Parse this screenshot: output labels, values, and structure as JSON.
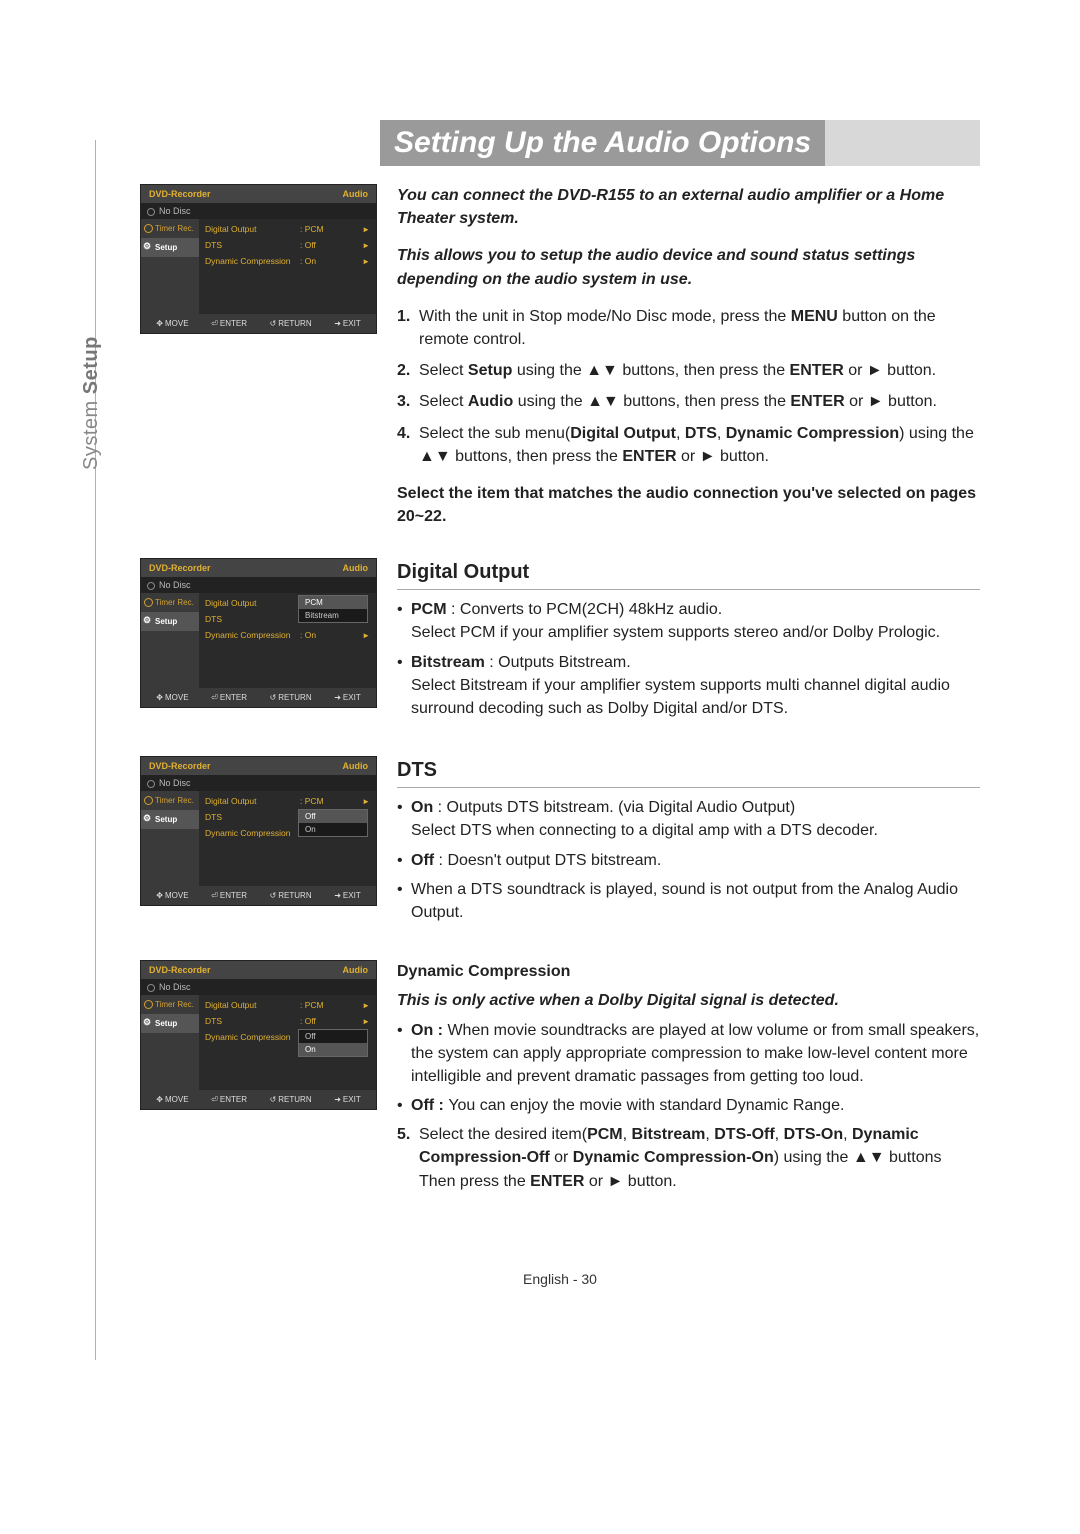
{
  "side_tab_a": "System ",
  "side_tab_b": "Setup",
  "title": "Setting Up the Audio Options",
  "intro1": "You can connect the DVD-R155 to an external audio amplifier or a Home Theater system.",
  "intro2": "This allows you to setup the audio device and sound status settings depending on the audio system in use.",
  "steps": {
    "s1a": "1.",
    "s1b": "With the unit in Stop mode/No Disc mode, press the ",
    "s1c": "MENU",
    "s1d": " button on the remote control.",
    "s2a": "2.",
    "s2b": "Select ",
    "s2c": "Setup",
    "s2d": " using the ▲▼ buttons, then press the ",
    "s2e": "ENTER",
    "s2f": " or ► button.",
    "s3a": "3.",
    "s3b": "Select ",
    "s3c": "Audio",
    "s3d": " using the ▲▼ buttons, then press the ",
    "s3e": "ENTER",
    "s3f": " or ► button.",
    "s4a": "4.",
    "s4b": "Select the sub menu(",
    "s4c": "Digital Output",
    "s4d": ", ",
    "s4e": "DTS",
    "s4f": ", ",
    "s4g": "Dynamic Compression",
    "s4h": ") using the ▲▼ buttons, then press the ",
    "s4i": "ENTER",
    "s4j": " or ► button."
  },
  "note": "Select the item that matches the audio connection you've selected on pages 20~22.",
  "digital_output": {
    "head": "Digital Output",
    "b1a": "PCM",
    "b1b": " : Converts to PCM(2CH) 48kHz audio.",
    "b1c": "Select PCM if your amplifier system supports stereo and/or Dolby Prologic.",
    "b2a": "Bitstream",
    "b2b": " : Outputs Bitstream.",
    "b2c": "Select Bitstream if your amplifier system supports multi channel digital audio surround decoding such as Dolby Digital and/or DTS."
  },
  "dts": {
    "head": "DTS",
    "b1a": "On",
    "b1b": " : Outputs DTS bitstream. (via Digital Audio Output)",
    "b1c": "Select DTS when connecting to a digital amp with a DTS decoder.",
    "b2a": "Off",
    "b2b": " : Doesn't output DTS bitstream.",
    "b3": "When a DTS soundtrack is played, sound is not output from the Analog Audio Output."
  },
  "dyn": {
    "head": "Dynamic Compression",
    "sub": "This is only active when a Dolby Digital signal is detected.",
    "b1a": "On : ",
    "b1b": "When movie soundtracks are played at low volume or from small speakers, the system can apply appropriate compression to make low-level content more intelligible and prevent dramatic passages from getting too loud.",
    "b2a": "Off : ",
    "b2b": "You can enjoy the movie with standard Dynamic Range.",
    "s5a": "5.",
    "s5b": "Select the desired item(",
    "s5c": "PCM",
    "s5d": ", ",
    "s5e": "Bitstream",
    "s5f": ", ",
    "s5g": "DTS-Off",
    "s5h": ", ",
    "s5i": "DTS-On",
    "s5j": ", ",
    "s5k": "Dynamic Compression-Off",
    "s5l": " or ",
    "s5m": "Dynamic Compression-On",
    "s5n": ") using the ▲▼ buttons",
    "s5o": "Then press the ",
    "s5p": "ENTER",
    "s5q": " or ► button."
  },
  "osd": {
    "title": "DVD-Recorder",
    "corner": "Audio",
    "nodisc": "No Disc",
    "left": {
      "timer": "Timer Rec.",
      "setup": "Setup"
    },
    "items": {
      "digital": "Digital Output",
      "dts": "DTS",
      "dyn": "Dynamic Compression"
    },
    "vals": {
      "pcm": ": PCM",
      "off": ": Off",
      "on": ": On"
    },
    "opts": {
      "pcm": "PCM",
      "bitstream": "Bitstream",
      "off": "Off",
      "on": "On"
    },
    "footer": {
      "move": "MOVE",
      "enter": "ENTER",
      "return": "RETURN",
      "exit": "EXIT"
    },
    "icons": {
      "move": "✥",
      "enter": "⏎",
      "return": "↺",
      "exit": "➜"
    }
  },
  "footer_page": "English - 30"
}
